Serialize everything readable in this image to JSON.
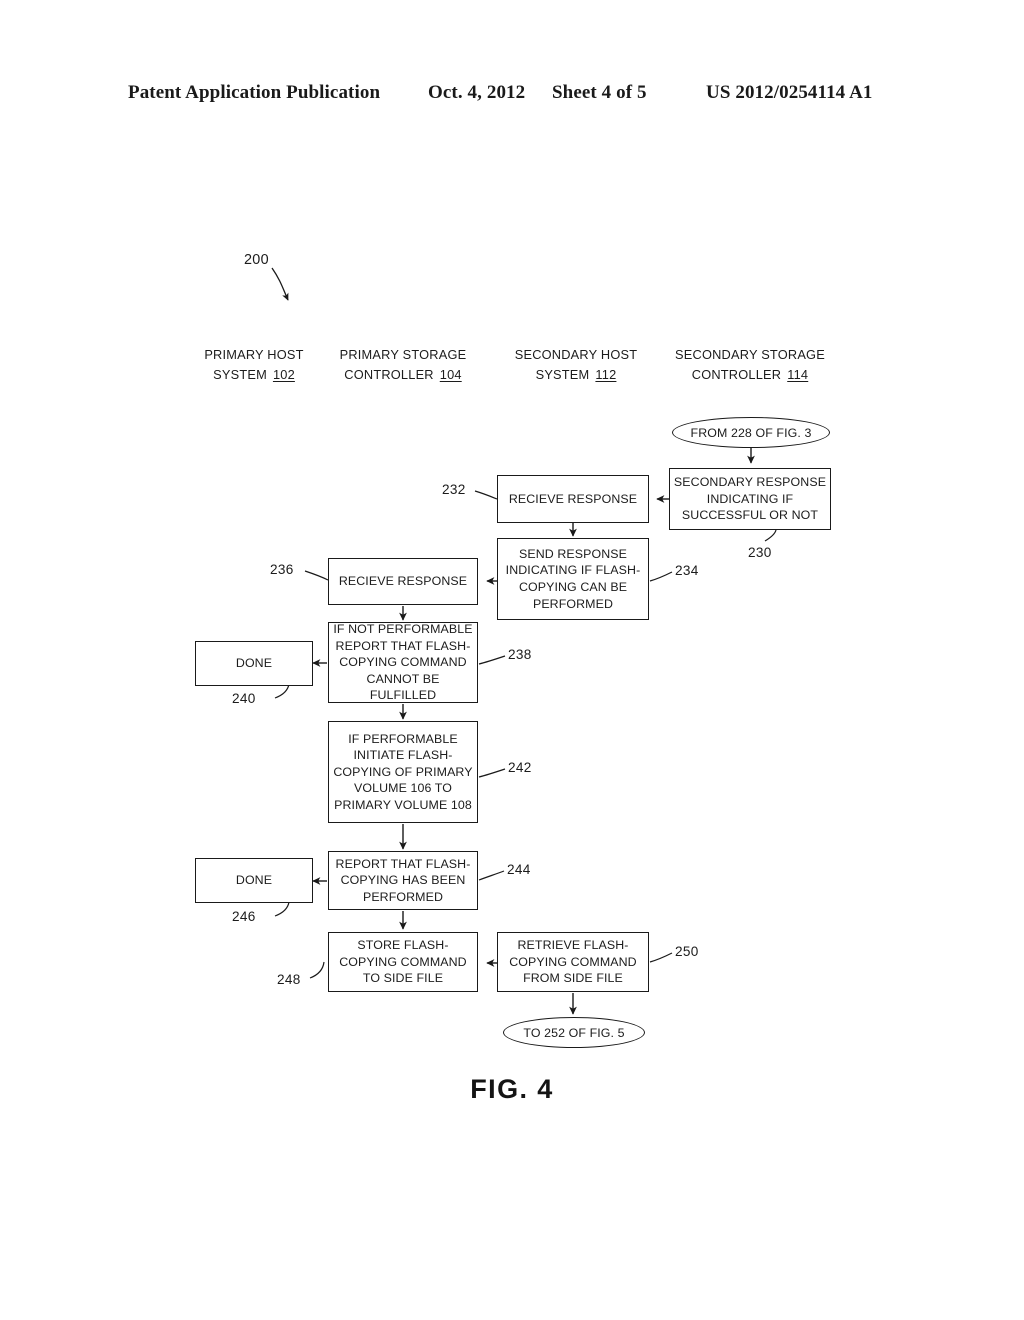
{
  "header": {
    "publication": "Patent Application Publication",
    "date": "Oct. 4, 2012",
    "sheet": "Sheet 4 of 5",
    "patent_number": "US 2012/0254114 A1"
  },
  "figure": {
    "caption": "FIG. 4",
    "diagram_ref": "200",
    "columns": [
      {
        "line1": "PRIMARY HOST",
        "line2": "SYSTEM",
        "ref": "102"
      },
      {
        "line1": "PRIMARY STORAGE",
        "line2": "CONTROLLER",
        "ref": "104"
      },
      {
        "line1": "SECONDARY HOST",
        "line2": "SYSTEM",
        "ref": "112"
      },
      {
        "line1": "SECONDARY STORAGE",
        "line2": "CONTROLLER",
        "ref": "114"
      }
    ],
    "connectors": [
      {
        "id": "from-228",
        "text": "FROM 228 OF FIG. 3"
      },
      {
        "id": "to-252",
        "text": "TO 252 OF FIG. 5"
      }
    ],
    "nodes": [
      {
        "id": "n230",
        "ref": "230",
        "column": 4,
        "text": "SECONDARY RESPONSE INDICATING IF SUCCESSFUL OR NOT"
      },
      {
        "id": "n232",
        "ref": "232",
        "column": 3,
        "text": "RECIEVE RESPONSE"
      },
      {
        "id": "n234",
        "ref": "234",
        "column": 3,
        "text": "SEND RESPONSE INDICATING IF FLASH-COPYING CAN BE PERFORMED"
      },
      {
        "id": "n236",
        "ref": "236",
        "column": 2,
        "text": "RECIEVE RESPONSE"
      },
      {
        "id": "n238",
        "ref": "238",
        "column": 2,
        "text": "IF NOT PERFORMABLE REPORT THAT FLASH-COPYING COMMAND CANNOT BE FULFILLED"
      },
      {
        "id": "n240",
        "ref": "240",
        "column": 1,
        "text": "DONE"
      },
      {
        "id": "n242",
        "ref": "242",
        "column": 2,
        "text": "IF PERFORMABLE INITIATE FLASH-COPYING OF PRIMARY VOLUME 106 TO PRIMARY VOLUME 108"
      },
      {
        "id": "n244",
        "ref": "244",
        "column": 2,
        "text": "REPORT THAT FLASH-COPYING HAS BEEN PERFORMED"
      },
      {
        "id": "n246",
        "ref": "246",
        "column": 1,
        "text": "DONE"
      },
      {
        "id": "n248",
        "ref": "248",
        "column": 2,
        "text": "STORE FLASH-COPYING COMMAND TO SIDE FILE"
      },
      {
        "id": "n250",
        "ref": "250",
        "column": 3,
        "text": "RETRIEVE FLASH-COPYING COMMAND FROM SIDE FILE"
      }
    ]
  },
  "colors": {
    "ink": "#1a1a1a",
    "paper": "#ffffff"
  }
}
